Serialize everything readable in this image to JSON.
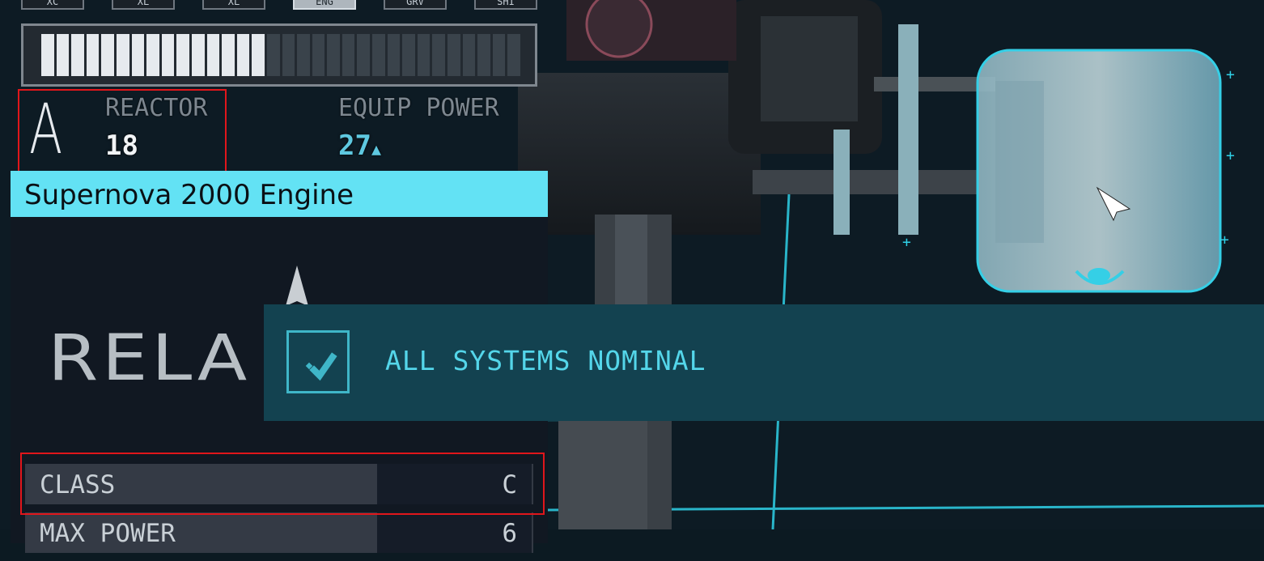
{
  "tabs": [
    {
      "label": "XC"
    },
    {
      "label": "XL"
    },
    {
      "label": "XL"
    },
    {
      "label": "ENG",
      "active": true
    },
    {
      "label": "GRV"
    },
    {
      "label": "SHI"
    }
  ],
  "power_bar": {
    "filled_segments": 15,
    "total_segments": 32
  },
  "reactor_class": "A",
  "reactor": {
    "label": "REACTOR",
    "value": "18"
  },
  "equip_power": {
    "label": "EQUIP POWER",
    "value": "27",
    "indicator": "▲"
  },
  "part": {
    "title": "Supernova 2000 Engine",
    "brand": "RELA",
    "stats": [
      {
        "label": "CLASS",
        "value": "C"
      },
      {
        "label": "MAX POWER",
        "value": "6"
      }
    ]
  },
  "notification": {
    "text": "ALL SYSTEMS NOMINAL",
    "icon": "checkmark-icon"
  },
  "colors": {
    "accent": "#63e2f4",
    "notification_bg": "#134250",
    "notification_text": "#54d6ea",
    "highlight_box": "#e0161b",
    "grid": "#2fd0e6"
  }
}
